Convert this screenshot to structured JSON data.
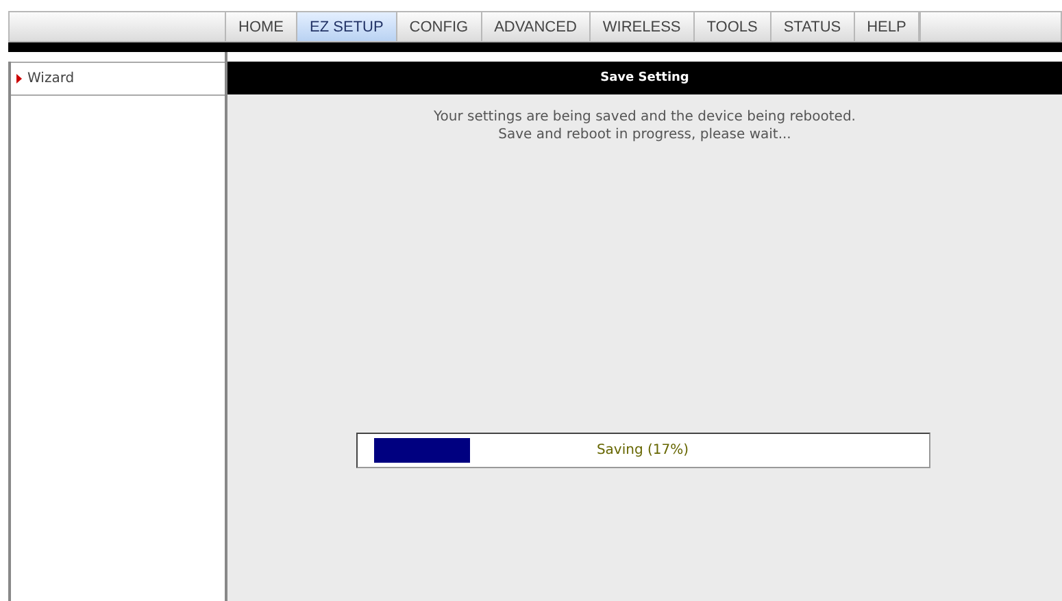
{
  "nav_tabs": [
    {
      "label": "HOME",
      "selected": false
    },
    {
      "label": "EZ SETUP",
      "selected": true
    },
    {
      "label": "CONFIG",
      "selected": false
    },
    {
      "label": "ADVANCED",
      "selected": false
    },
    {
      "label": "WIRELESS",
      "selected": false
    },
    {
      "label": "TOOLS",
      "selected": false
    },
    {
      "label": "STATUS",
      "selected": false
    },
    {
      "label": "HELP",
      "selected": false
    }
  ],
  "sidebar": {
    "items": [
      {
        "label": "Wizard",
        "selected": true
      }
    ]
  },
  "panel": {
    "title": "Save Setting",
    "message_lines": [
      "Your settings are being saved and the device being rebooted.",
      "Save and reboot in progress, please wait..."
    ],
    "progress": {
      "level": 0.17,
      "label": "Saving (17%)"
    }
  }
}
